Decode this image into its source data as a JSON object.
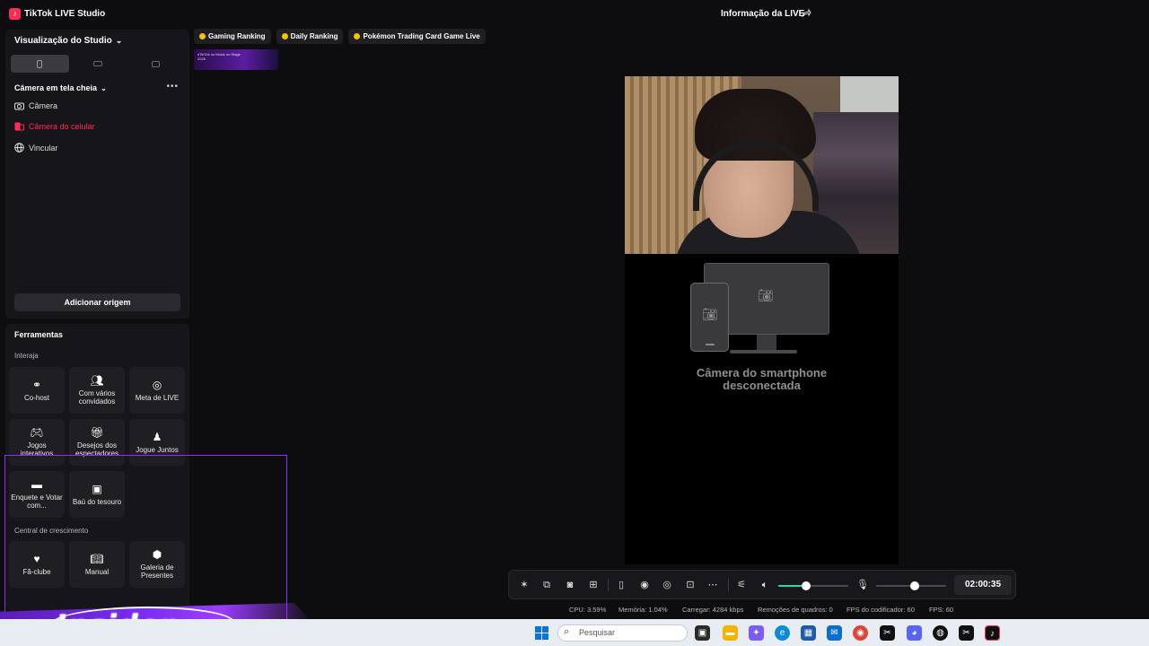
{
  "window": {
    "app_title": "TikTok LIVE Studio",
    "live_info_label": "Informação da LIVE"
  },
  "studio": {
    "title": "Visualização do Studio",
    "view_tabs": [
      "phone-portrait-icon",
      "landscape-icon",
      "dual-icon"
    ],
    "scene": {
      "title": "Câmera em tela cheia",
      "sources": [
        {
          "label": "Câmera",
          "icon": "camera-icon"
        },
        {
          "label": "Câmera do celular",
          "icon": "phone-camera-icon"
        },
        {
          "label": "Vincular",
          "icon": "globe-icon"
        }
      ]
    },
    "add_source_label": "Adicionar origem"
  },
  "tools": {
    "title": "Ferramentas",
    "interact_label": "Interaja",
    "growth_label": "Central de crescimento",
    "interact_items": [
      {
        "label": "Co-host",
        "icon": "link-icon"
      },
      {
        "label": "Com vários convidados",
        "icon": "users-icon"
      },
      {
        "label": "Meta de LIVE",
        "icon": "target-icon"
      },
      {
        "label": "Jogos interativos",
        "icon": "gamepad-icon"
      },
      {
        "label": "Desejos dos espectadores",
        "icon": "gift-icon"
      },
      {
        "label": "Jogue Juntos",
        "icon": "player-icon"
      },
      {
        "label": "Enquete e Votar com...",
        "icon": "poll-icon"
      },
      {
        "label": "Baú do tesouro",
        "icon": "chest-icon"
      }
    ],
    "growth_items": [
      {
        "label": "Fã-clube",
        "icon": "heart-icon"
      },
      {
        "label": "Manual",
        "icon": "book-icon"
      },
      {
        "label": "Galeria de Presentes",
        "icon": "gallery-icon"
      }
    ]
  },
  "chips": [
    {
      "label": "Gaming Ranking"
    },
    {
      "label": "Daily Ranking"
    },
    {
      "label": "Pokémon Trading Card Game Live"
    }
  ],
  "promo": {
    "text": "#TikTok no Music on Stage 2025"
  },
  "preview": {
    "disconnected_line1": "Câmera do smartphone",
    "disconnected_line2": "desconectada"
  },
  "controls": {
    "volume_level": 0.4,
    "mic_level": 0.55,
    "timer": "02:00:35",
    "accent": "#2ad9b0"
  },
  "stats": {
    "cpu": "CPU: 3.59%",
    "memory": "Memória: 1.04%",
    "upload": "Carregar: 4284 kbps",
    "frames_removed": "Remoções de quadros: 0",
    "encoder_fps": "FPS do codificador: 60",
    "fps": "FPS: 60"
  },
  "taskbar": {
    "search_placeholder": "Pesquisar"
  },
  "overlay": {
    "brand": "Insider"
  }
}
